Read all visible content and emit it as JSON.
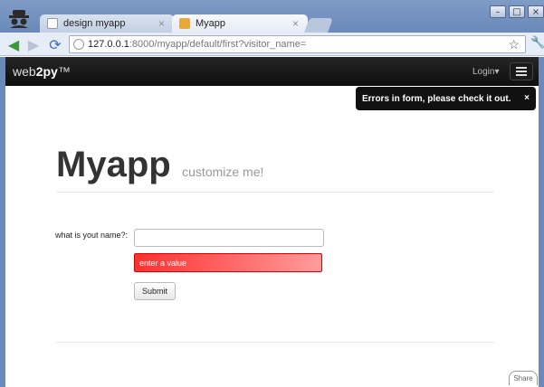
{
  "browser": {
    "tabs": [
      {
        "title": "design myapp",
        "active": false
      },
      {
        "title": "Myapp",
        "active": true
      }
    ],
    "close_glyph": "×",
    "window_controls": {
      "minimize": "–",
      "maximize": "□",
      "close": "×"
    },
    "address": {
      "host": "127.0.0.1",
      "rest": ":8000/myapp/default/first?visitor_name="
    }
  },
  "page": {
    "navbar": {
      "brand_prefix": "web",
      "brand_bold": "2py",
      "brand_suffix": "™",
      "login_label": "Login▾"
    },
    "flash": {
      "message": "Errors in form, please check it out.",
      "close": "×"
    },
    "header": {
      "title": "Myapp",
      "subtitle": "customize me!"
    },
    "form": {
      "label": "what is yout name?:",
      "input_value": "",
      "error_message": "enter a value",
      "submit_label": "Submit"
    },
    "share_label": "Share"
  },
  "colors": {
    "frame": "#6b89b9",
    "navbar": "#1a1a1a",
    "error": "#ff3030"
  }
}
